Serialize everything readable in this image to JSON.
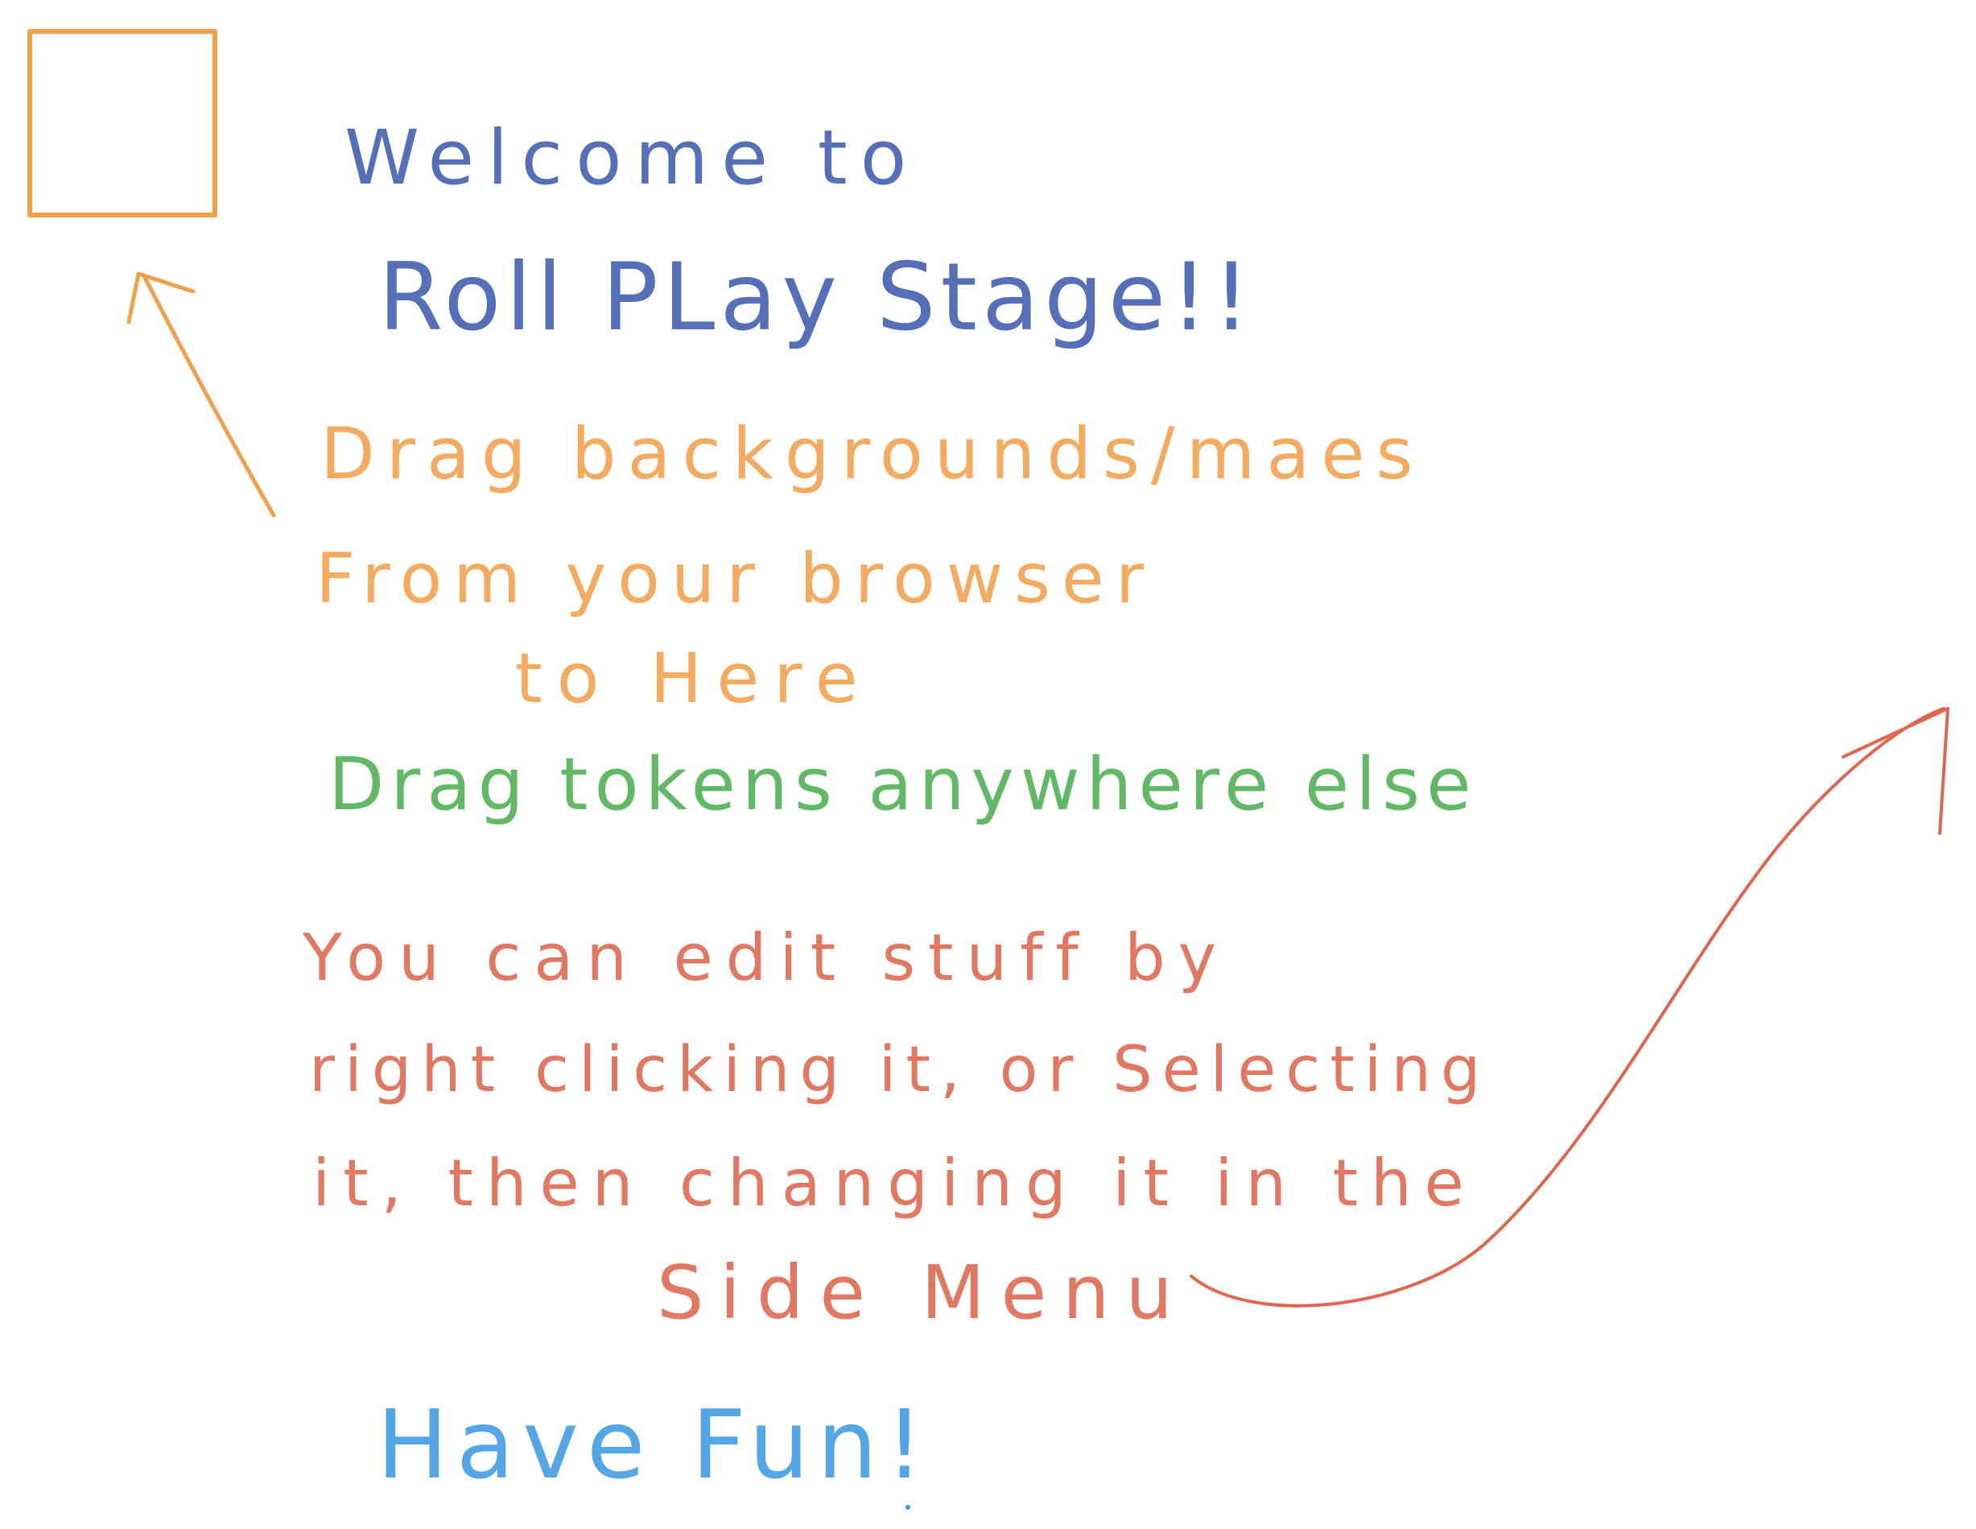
{
  "colors": {
    "background": "#ffffff",
    "title": "#3f5cb0",
    "orange_note": "#f4a04a",
    "green_note": "#4caf50",
    "red_note": "#e0664d",
    "have_fun": "#3d9ae3"
  },
  "welcome": {
    "line1": "Welcome to",
    "line2": "Roll PLay Stage!!"
  },
  "background_hint": {
    "line1": "Drag backgrounds/maes",
    "line2": "From your browser",
    "line3": "to Here"
  },
  "token_hint": {
    "text": "Drag tokens anywhere else"
  },
  "edit_hint": {
    "line1": "You can edit stuff by",
    "line2": "right clicking it, or Selecting",
    "line3": "it, then changing it in the",
    "line4": "Side Menu"
  },
  "closing": {
    "text": "Have Fun!"
  }
}
